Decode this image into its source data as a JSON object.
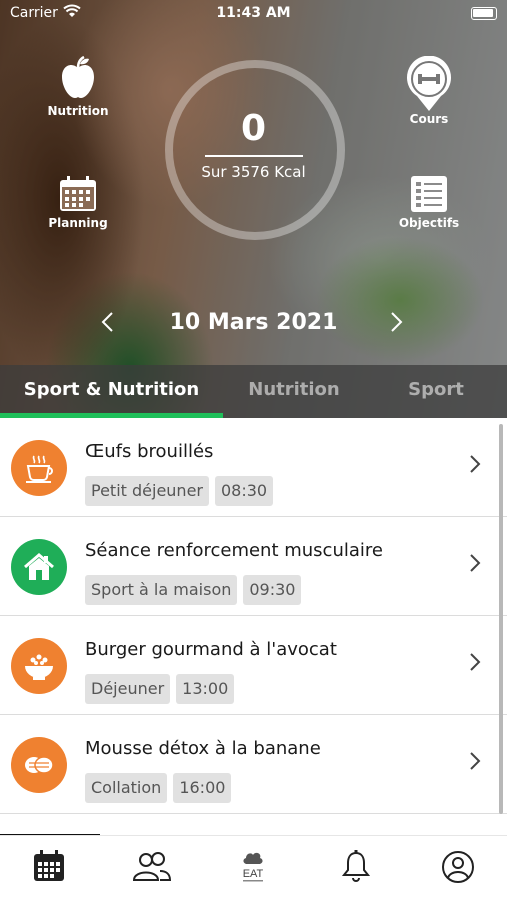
{
  "status_bar": {
    "carrier": "Carrier",
    "time": "11:43 AM"
  },
  "hero": {
    "kcal_value": "0",
    "kcal_label": "Sur 3576 Kcal",
    "nutrition_label": "Nutrition",
    "cours_label": "Cours",
    "planning_label": "Planning",
    "objectifs_label": "Objectifs",
    "date": "10 Mars 2021"
  },
  "tabs": [
    {
      "label": "Sport & Nutrition",
      "active": true
    },
    {
      "label": "Nutrition",
      "active": false
    },
    {
      "label": "Sport",
      "active": false
    }
  ],
  "colors": {
    "accent_green": "#1fbf5a",
    "meal_orange": "#ef8130",
    "sport_green": "#1fae58"
  },
  "items": [
    {
      "title": "Œufs brouillés",
      "tag": "Petit déjeuner",
      "time": "08:30",
      "icon": "coffee-cup-icon",
      "color": "#ef8130"
    },
    {
      "title": "Séance renforcement musculaire",
      "tag": "Sport à la maison",
      "time": "09:30",
      "icon": "house-icon",
      "color": "#1fae58"
    },
    {
      "title": "Burger gourmand à l'avocat",
      "tag": "Déjeuner",
      "time": "13:00",
      "icon": "bowl-icon",
      "color": "#ef8130"
    },
    {
      "title": "Mousse détox à la banane",
      "tag": "Collation",
      "time": "16:00",
      "icon": "cookies-icon",
      "color": "#ef8130"
    }
  ],
  "bottom_nav": [
    {
      "icon": "calendar-icon"
    },
    {
      "icon": "community-icon"
    },
    {
      "icon": "eat-logo-icon",
      "text": "EAT"
    },
    {
      "icon": "bell-icon"
    },
    {
      "icon": "profile-icon"
    }
  ]
}
